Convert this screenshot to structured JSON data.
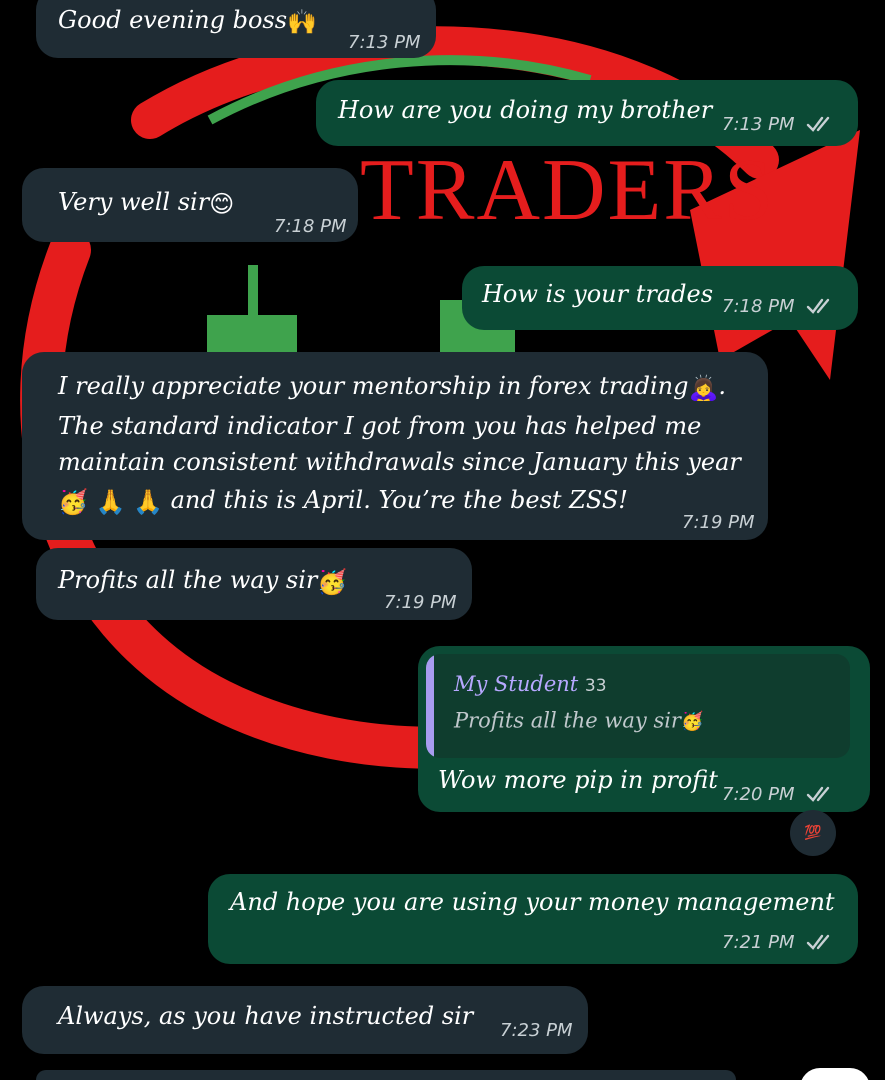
{
  "wallpaper": {
    "brand_text": "TRADERS",
    "colors": {
      "red": "#e51d1d",
      "green": "#3fa34d"
    }
  },
  "colors": {
    "incoming_bubble": "#1f2c34",
    "outgoing_bubble": "#0b4a35",
    "read_ticks": "#c8d0d4",
    "quote_bar": "#a89cf0"
  },
  "messages": [
    {
      "direction": "incoming",
      "text": "Good evening boss",
      "emoji": "🙌",
      "time": "7:13 PM"
    },
    {
      "direction": "outgoing",
      "text": "How are you doing  my brother",
      "time": "7:13 PM",
      "ticks": "double-check-icon"
    },
    {
      "direction": "incoming",
      "text": "Very well sir",
      "emoji": "😊",
      "time": "7:18 PM"
    },
    {
      "direction": "outgoing",
      "text": "How is your trades",
      "time": "7:18 PM",
      "ticks": "double-check-icon"
    },
    {
      "direction": "incoming",
      "lines": [
        "I really appreciate your mentorship in forex trading",
        "The standard indicator I got from you has helped me",
        "maintain consistent withdrawals since January this year",
        "and this is April. You’re the best ZSS!"
      ],
      "emojis": [
        "🙇‍♀️",
        "🥳",
        "🙏",
        "🙏"
      ],
      "time": "7:19 PM"
    },
    {
      "direction": "incoming",
      "text": "Profits all the way sir",
      "emoji": "🥳",
      "time": "7:19 PM"
    },
    {
      "direction": "outgoing",
      "quote": {
        "author": "My Student",
        "author_suffix": "33",
        "text": "Profits all the way sir",
        "emoji": "🥳"
      },
      "text": "Wow more pip in profit",
      "time": "7:20 PM",
      "ticks": "double-check-icon",
      "reaction": "💯"
    },
    {
      "direction": "outgoing",
      "text": "And hope you are using your money management",
      "time": "7:21 PM",
      "ticks": "double-check-icon"
    },
    {
      "direction": "incoming",
      "text": "Always, as you have instructed sir",
      "time": "7:23 PM"
    }
  ]
}
